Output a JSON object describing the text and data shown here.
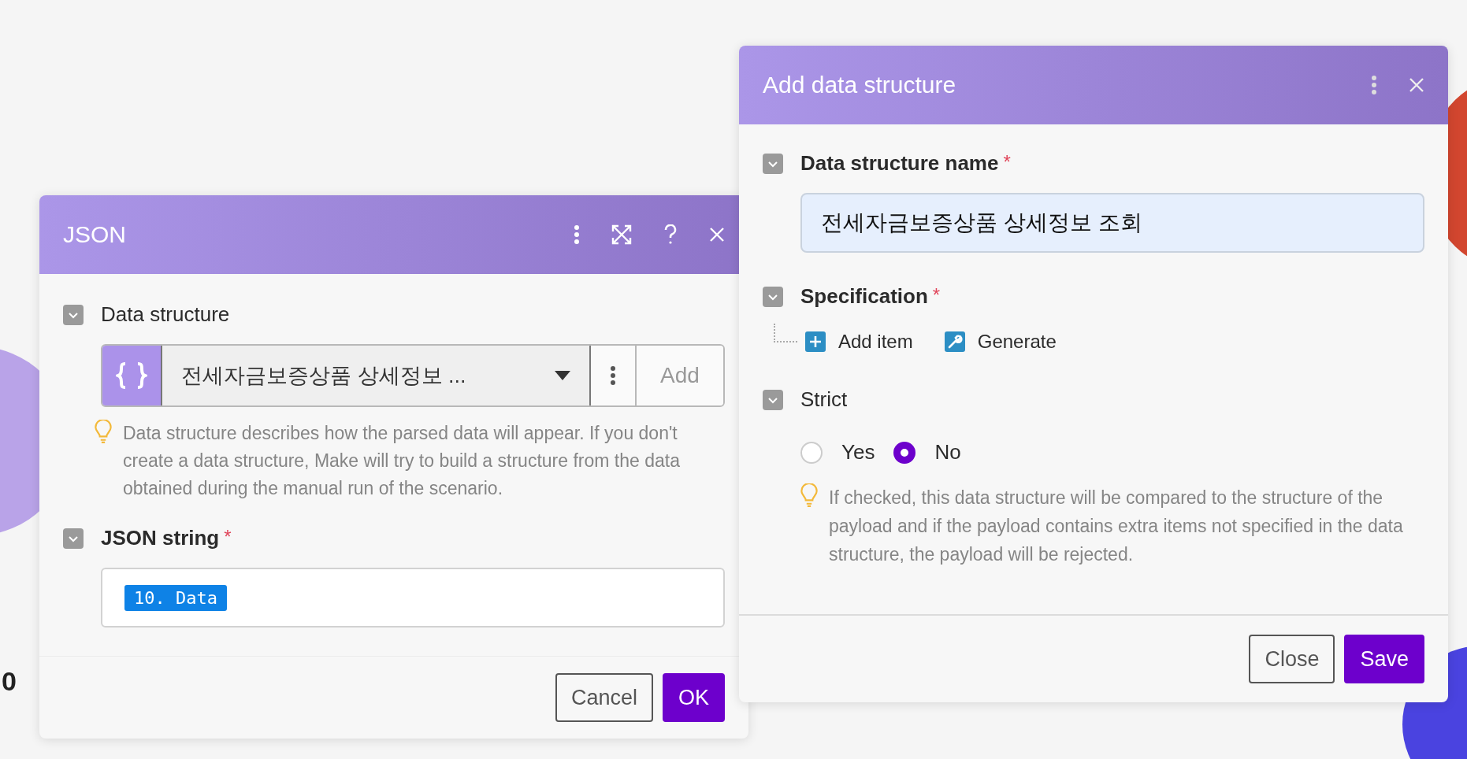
{
  "canvas": {
    "label": "0"
  },
  "json_module": {
    "title": "JSON",
    "data_structure": {
      "label": "Data structure",
      "value": "전세자금보증상품 상세정보 ...",
      "add_button": "Add",
      "hint": "Data structure describes how the parsed data will appear. If you don't create a data structure, Make will try to build a structure from the data obtained during the manual run of the scenario."
    },
    "json_string": {
      "label": "JSON string",
      "required_mark": "*",
      "tag": "10. Data"
    },
    "buttons": [
      {
        "label": "Cancel",
        "primary": false
      },
      {
        "label": "OK",
        "primary": true
      }
    ]
  },
  "add_panel": {
    "title": "Add data structure",
    "name_field": {
      "label": "Data structure name",
      "required_mark": "*",
      "value": "전세자금보증상품 상세정보 조회"
    },
    "specification": {
      "label": "Specification",
      "required_mark": "*",
      "actions": [
        {
          "label": "Add item",
          "kind": "add"
        },
        {
          "label": "Generate",
          "kind": "generate"
        }
      ]
    },
    "strict": {
      "label": "Strict",
      "options": [
        {
          "label": "Yes",
          "selected": false
        },
        {
          "label": "No",
          "selected": true
        }
      ],
      "hint": "If checked, this data structure will be compared to the structure of the payload and if the payload contains extra items not specified in the data structure, the payload will be rejected."
    },
    "buttons": [
      {
        "label": "Close",
        "primary": false
      },
      {
        "label": "Save",
        "primary": true
      }
    ]
  }
}
